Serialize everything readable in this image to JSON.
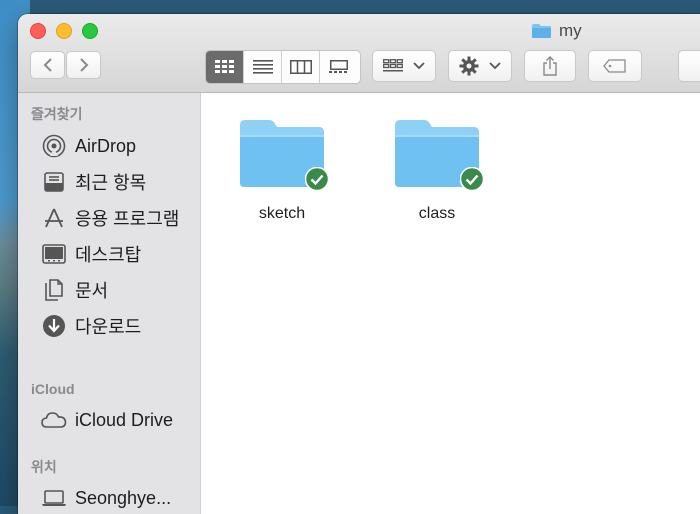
{
  "window": {
    "title": "my"
  },
  "toolbar": {
    "nav": {
      "back_label": "back",
      "forward_label": "forward"
    },
    "view_modes": [
      "icon-view",
      "list-view",
      "column-view",
      "gallery-view"
    ],
    "active_view": "icon-view"
  },
  "sidebar": {
    "favorites_header": "즐겨찾기",
    "favorites": [
      {
        "label": "AirDrop",
        "icon": "airdrop-icon"
      },
      {
        "label": "최근 항목",
        "icon": "recents-icon"
      },
      {
        "label": "응용 프로그램",
        "icon": "applications-icon"
      },
      {
        "label": "데스크탑",
        "icon": "desktop-icon"
      },
      {
        "label": "문서",
        "icon": "documents-icon"
      },
      {
        "label": "다운로드",
        "icon": "downloads-icon"
      }
    ],
    "icloud_header": "iCloud",
    "icloud": [
      {
        "label": "iCloud Drive",
        "icon": "cloud-icon"
      }
    ],
    "locations_header": "위치",
    "locations": [
      {
        "label": "Seonghye...",
        "icon": "laptop-icon"
      }
    ]
  },
  "files": [
    {
      "name": "sketch",
      "status": "synced"
    },
    {
      "name": "class",
      "status": "synced"
    }
  ],
  "colors": {
    "folder": "#6ec1f0",
    "folder_tab": "#8fd1f6",
    "badge": "#3a8a4c"
  }
}
